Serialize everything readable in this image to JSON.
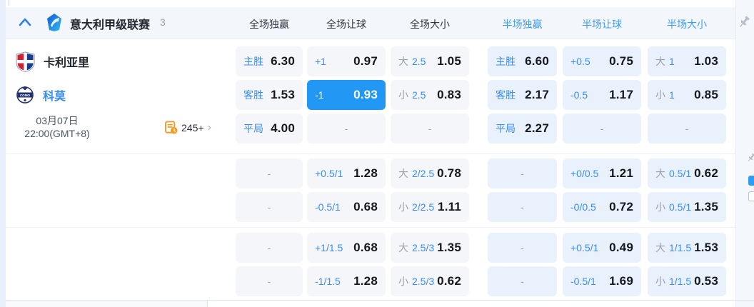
{
  "header": {
    "league_name": "意大利甲级联赛",
    "match_count": "3",
    "columns": [
      {
        "label": "全场独赢"
      },
      {
        "label": "全场让球"
      },
      {
        "label": "全场大小"
      },
      {
        "label": "半场独赢"
      },
      {
        "label": "半场让球"
      },
      {
        "label": "半场大小"
      }
    ]
  },
  "match": {
    "home_team": "卡利亚里",
    "away_team": "科莫",
    "date": "03月07日",
    "time": "22:00(GMT+8)",
    "more_markets": "245+"
  },
  "odds": {
    "dash": "-",
    "rows": [
      {
        "cells": [
          {
            "l": "主胜",
            "v": "6.30"
          },
          {
            "l": "+1",
            "v": "0.97"
          },
          {
            "p": "大",
            "l": "2.5",
            "v": "1.05"
          },
          {
            "l": "主胜",
            "v": "6.60"
          },
          {
            "l": "+0.5",
            "v": "0.75"
          },
          {
            "p": "大",
            "l": "1",
            "v": "1.03"
          }
        ]
      },
      {
        "cells": [
          {
            "l": "客胜",
            "v": "1.53"
          },
          {
            "l": "-1",
            "v": "0.93",
            "highlighted": true
          },
          {
            "p": "小",
            "l": "2.5",
            "v": "0.83"
          },
          {
            "l": "客胜",
            "v": "2.17"
          },
          {
            "l": "-0.5",
            "v": "1.17"
          },
          {
            "p": "小",
            "l": "1",
            "v": "0.85"
          }
        ]
      },
      {
        "cells": [
          {
            "l": "平局",
            "v": "4.00"
          },
          {},
          {},
          {
            "l": "平局",
            "v": "2.27"
          },
          {},
          {}
        ]
      },
      {
        "cells": [
          {},
          {
            "l": "+0.5/1",
            "v": "1.28"
          },
          {
            "p": "大",
            "l": "2/2.5",
            "v": "0.78"
          },
          {},
          {
            "l": "+0/0.5",
            "v": "1.21"
          },
          {
            "p": "大",
            "l": "0.5/1",
            "v": "0.62"
          }
        ]
      },
      {
        "cells": [
          {},
          {
            "l": "-0.5/1",
            "v": "0.68"
          },
          {
            "p": "小",
            "l": "2/2.5",
            "v": "1.11"
          },
          {},
          {
            "l": "-0/0.5",
            "v": "0.72"
          },
          {
            "p": "小",
            "l": "0.5/1",
            "v": "1.35"
          }
        ]
      },
      {
        "cells": [
          {},
          {
            "l": "+1/1.5",
            "v": "0.68"
          },
          {
            "p": "大",
            "l": "2.5/3",
            "v": "1.35"
          },
          {},
          {
            "l": "+0.5/1",
            "v": "0.49"
          },
          {
            "p": "大",
            "l": "1/1.5",
            "v": "1.53"
          }
        ]
      },
      {
        "cells": [
          {},
          {
            "l": "-1/1.5",
            "v": "1.28"
          },
          {
            "p": "小",
            "l": "2.5/3",
            "v": "0.62"
          },
          {},
          {
            "l": "-0.5/1",
            "v": "1.69"
          },
          {
            "p": "小",
            "l": "1/1.5",
            "v": "0.53"
          }
        ]
      }
    ]
  },
  "colors": {
    "accent_blue": "#3b8cf0",
    "highlight_bg": "#2397f4",
    "half_cell_bg": "#e9f2fc",
    "full_cell_bg": "#f4f6f9",
    "orange_icon": "#f59a23"
  }
}
